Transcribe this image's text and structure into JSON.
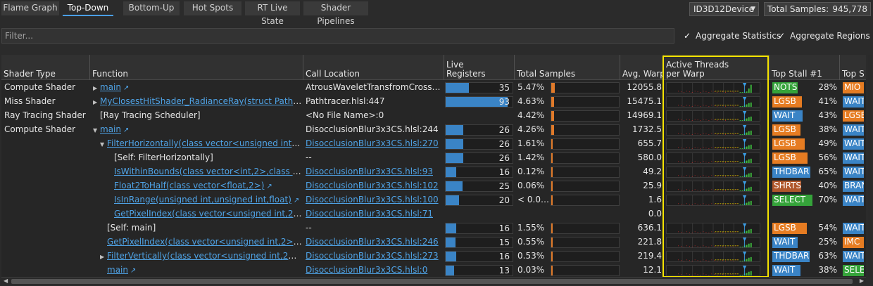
{
  "tabs": [
    "Flame Graph",
    "Top-Down",
    "Bottom-Up",
    "Hot Spots",
    "RT Live State",
    "Shader Pipelines"
  ],
  "active_tab": 1,
  "device": "ID3D12Device",
  "total_samples_label": "Total Samples:",
  "total_samples_value": "945,778",
  "filter_placeholder": "Filter...",
  "aggregate_statistics": "Aggregate Statistics",
  "aggregate_regions": "Aggregate Regions",
  "columns": {
    "shader_type": "Shader Type",
    "function": "Function",
    "call_location": "Call Location",
    "live_registers": "Live\nRegisters",
    "total_samples": "Total Samples",
    "avg_warp": "Avg. Warp",
    "active_threads": "Active Threads\nper Warp",
    "top_stall": "Top Stall #1",
    "top_stall2": "Top S"
  },
  "colors": {
    "NOTSEL": "#35a33a",
    "LGSB": "#e67c22",
    "WAIT": "#3a84c6",
    "THDBAR": "#3a84c6",
    "SHRTSB": "#b0572b",
    "SELECT": "#35a33a",
    "MIO": "#e67c22",
    "LGSE": "#e67c22",
    "BRAN": "#3a84c6",
    "IMC": "#e67c22",
    "SELE": "#35a33a"
  },
  "rows": [
    {
      "type": "Compute Shader",
      "indent": 0,
      "exp": "collapsed",
      "func": "main",
      "link": true,
      "loc": "AtrousWaveletTransfromCrossBilat...",
      "loc_link": false,
      "reg": 35,
      "samples": "5.47%",
      "sfrac": 0.055,
      "warp": "12055.8",
      "stall": "NOTSEL",
      "stall_pct": "28%",
      "stall_frac": 0.28,
      "top2": "MIO",
      "at": [
        [
          0.95,
          0.02
        ],
        [
          1,
          0.05
        ],
        [
          2,
          0.1
        ],
        [
          3,
          0.12
        ],
        [
          4,
          0.5
        ],
        [
          5,
          0.95
        ]
      ]
    },
    {
      "type": "Miss Shader",
      "indent": 0,
      "exp": "collapsed",
      "func": "MyClosestHitShader_RadianceRay(struct Pathtrace...",
      "link": true,
      "loc": "Pathtracer.hlsl:447",
      "loc_link": false,
      "reg": 93,
      "samples": "4.63%",
      "sfrac": 0.046,
      "warp": "15475.1",
      "stall": "LGSB",
      "stall_pct": "41%",
      "stall_frac": 0.41,
      "top2": "WAIT",
      "at": [
        [
          0.9,
          0.05
        ],
        [
          1,
          0.1
        ],
        [
          2,
          0.2
        ],
        [
          3,
          0.3
        ],
        [
          4,
          0.4
        ],
        [
          5,
          0.5
        ]
      ]
    },
    {
      "type": "Ray Tracing Shader",
      "indent": 0,
      "exp": "",
      "func": "[Ray Tracing Scheduler]",
      "link": false,
      "loc": "<No File Name>:0",
      "loc_link": false,
      "reg": null,
      "samples": "4.42%",
      "sfrac": 0.044,
      "warp": "14969.1",
      "stall": "WAIT",
      "stall_pct": "43%",
      "stall_frac": 0.43,
      "top2": "LGSE",
      "at": [
        [
          0.9,
          0.05
        ],
        [
          1,
          0.1
        ],
        [
          2,
          0.2
        ],
        [
          3,
          0.3
        ],
        [
          4,
          0.4
        ],
        [
          5,
          0.5
        ]
      ]
    },
    {
      "type": "Compute Shader",
      "indent": 0,
      "exp": "expanded",
      "func": "main",
      "link": true,
      "loc": "DisocclusionBlur3x3CS.hlsl:244",
      "loc_link": false,
      "reg": 26,
      "samples": "4.26%",
      "sfrac": 0.043,
      "warp": "1732.5",
      "stall": "LGSB",
      "stall_pct": "38%",
      "stall_frac": 0.38,
      "top2": "WAIT",
      "at": [
        [
          0.9,
          0.05
        ],
        [
          1,
          0.1
        ],
        [
          2,
          0.2
        ],
        [
          3,
          0.3
        ],
        [
          4,
          0.4
        ],
        [
          5,
          0.5
        ]
      ]
    },
    {
      "type": "",
      "indent": 1,
      "exp": "expanded",
      "func": "FilterHorizontally(class vector<unsigned int,2>,u...",
      "link": true,
      "loc": "DisocclusionBlur3x3CS.hlsl:270",
      "loc_link": true,
      "reg": 26,
      "samples": "1.61%",
      "sfrac": 0.016,
      "warp": "655.7",
      "stall": "LGSB",
      "stall_pct": "49%",
      "stall_frac": 0.49,
      "top2": "WAIT",
      "at": [
        [
          0.9,
          0.05
        ],
        [
          1,
          0.1
        ],
        [
          2,
          0.2
        ],
        [
          3,
          0.3
        ],
        [
          4,
          0.4
        ],
        [
          5,
          0.5
        ]
      ]
    },
    {
      "type": "",
      "indent": 2,
      "exp": "",
      "func": "[Self: FilterHorizontally]",
      "link": false,
      "loc": "--",
      "loc_link": false,
      "reg": 26,
      "samples": "1.42%",
      "sfrac": 0.014,
      "warp": "580.0",
      "stall": "LGSB",
      "stall_pct": "56%",
      "stall_frac": 0.56,
      "top2": "WAIT",
      "at": [
        [
          0.9,
          0.05
        ],
        [
          1,
          0.1
        ],
        [
          2,
          0.2
        ],
        [
          3,
          0.3
        ],
        [
          4,
          0.4
        ],
        [
          5,
          0.5
        ]
      ]
    },
    {
      "type": "",
      "indent": 2,
      "exp": "",
      "func": "IsWithinBounds(class vector<int,2>,class vect...",
      "link": true,
      "loc": "DisocclusionBlur3x3CS.hlsl:93",
      "loc_link": true,
      "reg": 16,
      "samples": "0.12%",
      "sfrac": 0.001,
      "warp": "49.2",
      "stall": "THDBAR",
      "stall_pct": "65%",
      "stall_frac": 0.65,
      "top2": "WAIT",
      "at": [
        [
          0.9,
          0.05
        ],
        [
          1,
          0.1
        ],
        [
          2,
          0.2
        ],
        [
          3,
          0.3
        ],
        [
          4,
          0.4
        ],
        [
          5,
          0.5
        ]
      ]
    },
    {
      "type": "",
      "indent": 2,
      "exp": "",
      "func": "Float2ToHalf(class vector<float,2>)",
      "link": true,
      "loc": "DisocclusionBlur3x3CS.hlsl:102",
      "loc_link": true,
      "reg": 25,
      "samples": "0.06%",
      "sfrac": 0.001,
      "warp": "25.9",
      "stall": "SHRTSB",
      "stall_pct": "40%",
      "stall_frac": 0.4,
      "top2": "BRAN",
      "at": [
        [
          0.9,
          0.05
        ],
        [
          1,
          0.1
        ],
        [
          2,
          0.2
        ],
        [
          3,
          0.3
        ],
        [
          4,
          0.4
        ],
        [
          5,
          0.5
        ]
      ]
    },
    {
      "type": "",
      "indent": 2,
      "exp": "",
      "func": "IsInRange(unsigned int,unsigned int,float)",
      "link": true,
      "loc": "DisocclusionBlur3x3CS.hlsl:100",
      "loc_link": true,
      "reg": 20,
      "samples": "< 0.01%",
      "sfrac": 0,
      "warp": "1.6",
      "stall": "SELECT",
      "stall_pct": "70%",
      "stall_frac": 0.7,
      "top2": "WAIT",
      "at": [
        [
          0.9,
          0.05
        ],
        [
          1,
          0.1
        ],
        [
          2,
          0.2
        ],
        [
          3,
          0.3
        ],
        [
          4,
          0.4
        ],
        [
          5,
          0.5
        ]
      ]
    },
    {
      "type": "",
      "indent": 2,
      "exp": "",
      "func": "GetPixelIndex(class vector<unsigned int,2>,cla...",
      "link": true,
      "loc": "DisocclusionBlur3x3CS.hlsl:71",
      "loc_link": true,
      "reg": null,
      "samples": "",
      "sfrac": null,
      "warp": "0.0",
      "stall": "",
      "stall_pct": "",
      "stall_frac": 0,
      "top2": "",
      "at": null
    },
    {
      "type": "",
      "indent": 1,
      "exp": "",
      "func": "[Self: main]",
      "link": false,
      "loc": "--",
      "loc_link": false,
      "reg": 16,
      "samples": "1.55%",
      "sfrac": 0.016,
      "warp": "636.1",
      "stall": "LGSB",
      "stall_pct": "54%",
      "stall_frac": 0.54,
      "top2": "WAIT",
      "at": [
        [
          0.9,
          0.05
        ],
        [
          1,
          0.1
        ],
        [
          2,
          0.2
        ],
        [
          3,
          0.3
        ],
        [
          4,
          0.4
        ],
        [
          5,
          0.5
        ]
      ]
    },
    {
      "type": "",
      "indent": 1,
      "exp": "",
      "func": "GetPixelIndex(class vector<unsigned int,2>,class...",
      "link": true,
      "loc": "DisocclusionBlur3x3CS.hlsl:246",
      "loc_link": true,
      "reg": 15,
      "samples": "0.55%",
      "sfrac": 0.006,
      "warp": "221.8",
      "stall": "WAIT",
      "stall_pct": "25%",
      "stall_frac": 0.25,
      "top2": "IMC",
      "at": [
        [
          0.9,
          0.05
        ],
        [
          1,
          0.1
        ],
        [
          2,
          0.2
        ],
        [
          3,
          0.3
        ],
        [
          4,
          0.4
        ],
        [
          5,
          0.5
        ]
      ]
    },
    {
      "type": "",
      "indent": 1,
      "exp": "collapsed",
      "func": "FilterVertically(class vector<unsigned int,2>,clas...",
      "link": true,
      "loc": "DisocclusionBlur3x3CS.hlsl:273",
      "loc_link": true,
      "reg": 16,
      "samples": "0.53%",
      "sfrac": 0.005,
      "warp": "219.4",
      "stall": "THDBAR",
      "stall_pct": "63%",
      "stall_frac": 0.63,
      "top2": "WAIT",
      "at": [
        [
          0.9,
          0.05
        ],
        [
          1,
          0.1
        ],
        [
          2,
          0.2
        ],
        [
          3,
          0.3
        ],
        [
          4,
          0.4
        ],
        [
          5,
          0.5
        ]
      ]
    },
    {
      "type": "",
      "indent": 1,
      "exp": "",
      "func": "main",
      "link": true,
      "loc": "DisocclusionBlur3x3CS.hlsl:0",
      "loc_link": true,
      "reg": 13,
      "samples": "0.03%",
      "sfrac": 0.001,
      "warp": "12.1",
      "stall": "WAIT",
      "stall_pct": "38%",
      "stall_frac": 0.38,
      "top2": "SELE",
      "at": [
        [
          0.9,
          0.05
        ],
        [
          1,
          0.1
        ],
        [
          2,
          0.2
        ],
        [
          3,
          0.3
        ],
        [
          4,
          0.4
        ],
        [
          5,
          0.5
        ]
      ]
    }
  ]
}
